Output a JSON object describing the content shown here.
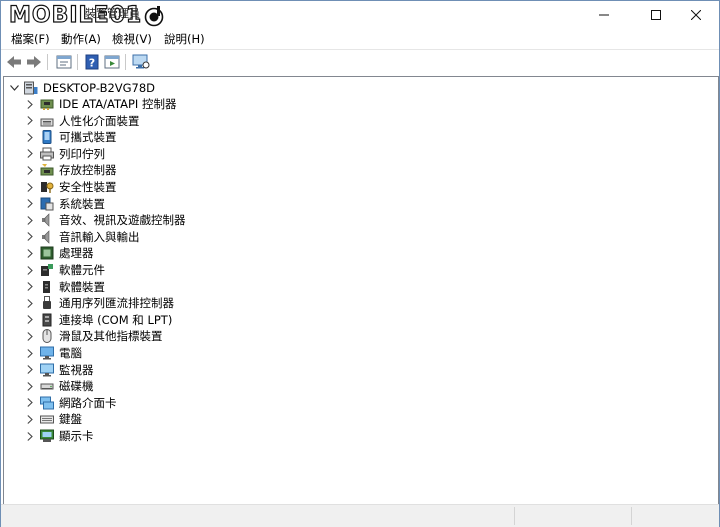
{
  "window": {
    "title": "裝置管理員"
  },
  "watermark": {
    "text": "MOBILE01"
  },
  "menu": [
    {
      "label": "檔案(F)"
    },
    {
      "label": "動作(A)"
    },
    {
      "label": "檢視(V)"
    },
    {
      "label": "說明(H)"
    }
  ],
  "toolbar": [
    "back-arrow-icon",
    "forward-arrow-icon",
    "properties-icon",
    "help-icon",
    "run-icon",
    "monitor-icon"
  ],
  "tree": {
    "root": "DESKTOP-B2VG78D",
    "items": [
      {
        "label": "IDE ATA/ATAPI 控制器",
        "icon": "ide-controller-icon"
      },
      {
        "label": "人性化介面裝置",
        "icon": "hid-icon"
      },
      {
        "label": "可攜式裝置",
        "icon": "portable-device-icon"
      },
      {
        "label": "列印佇列",
        "icon": "printer-icon"
      },
      {
        "label": "存放控制器",
        "icon": "storage-controller-icon"
      },
      {
        "label": "安全性裝置",
        "icon": "security-device-icon"
      },
      {
        "label": "系統裝置",
        "icon": "system-device-icon"
      },
      {
        "label": "音效、視訊及遊戲控制器",
        "icon": "speaker-icon"
      },
      {
        "label": "音訊輸入與輸出",
        "icon": "audio-io-icon"
      },
      {
        "label": "處理器",
        "icon": "processor-icon"
      },
      {
        "label": "軟體元件",
        "icon": "software-component-icon"
      },
      {
        "label": "軟體裝置",
        "icon": "software-device-icon"
      },
      {
        "label": "通用序列匯流排控制器",
        "icon": "usb-icon"
      },
      {
        "label": "連接埠 (COM 和 LPT)",
        "icon": "port-icon"
      },
      {
        "label": "滑鼠及其他指標裝置",
        "icon": "mouse-icon"
      },
      {
        "label": "電腦",
        "icon": "computer-icon"
      },
      {
        "label": "監視器",
        "icon": "monitor-icon"
      },
      {
        "label": "磁碟機",
        "icon": "disk-drive-icon"
      },
      {
        "label": "網路介面卡",
        "icon": "network-adapter-icon"
      },
      {
        "label": "鍵盤",
        "icon": "keyboard-icon"
      },
      {
        "label": "顯示卡",
        "icon": "display-adapter-icon"
      }
    ]
  },
  "colors": {
    "accent": "#3c8bd6",
    "frame": "#6f8fb5",
    "selection": "#cce8ff"
  }
}
